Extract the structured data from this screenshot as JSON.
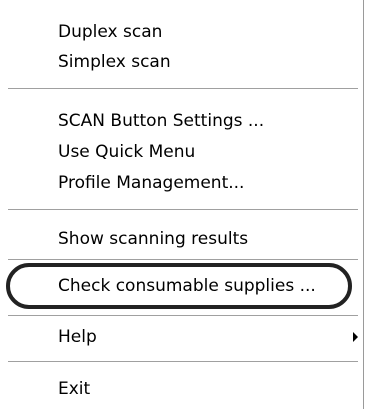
{
  "menu": {
    "items": [
      {
        "label": "Duplex scan"
      },
      {
        "label": "Simplex scan"
      },
      {
        "label": "SCAN Button Settings ..."
      },
      {
        "label": "Use Quick Menu"
      },
      {
        "label": "Profile Management..."
      },
      {
        "label": "Show scanning results"
      },
      {
        "label": "Check consumable supplies ..."
      },
      {
        "label": "Help",
        "has_submenu": true
      },
      {
        "label": "Exit"
      }
    ],
    "highlighted_item": "Check consumable supplies ...",
    "icons": {
      "submenu": "chevron-right-icon"
    },
    "colors": {
      "background": "#ffffff",
      "text": "#000000",
      "separator": "#a0a0a0",
      "highlight_ring": "#222222"
    }
  }
}
